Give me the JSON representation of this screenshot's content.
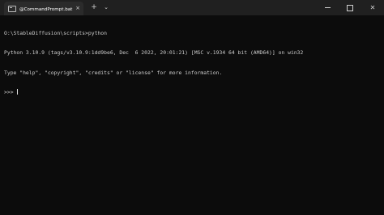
{
  "tab": {
    "title": "@CommandPrompt.bat - ショー",
    "icon": "terminal-icon",
    "close_glyph": "×"
  },
  "titlebar": {
    "new_tab_glyph": "+",
    "dropdown_glyph": "⌄",
    "minimize_icon": "minimize-icon",
    "maximize_icon": "maximize-icon",
    "close_glyph": "✕"
  },
  "terminal": {
    "lines": [
      "O:\\StableDiffusion\\scripts>python",
      "Python 3.10.9 (tags/v3.10.9:1dd9be6, Dec  6 2022, 20:01:21) [MSC v.1934 64 bit (AMD64)] on win32",
      "Type \"help\", \"copyright\", \"credits\" or \"license\" for more information.",
      ">>> "
    ]
  },
  "colors": {
    "background": "#0c0c0c",
    "titlebar": "#202020",
    "tab": "#2b2b2b",
    "text": "#cccccc"
  }
}
